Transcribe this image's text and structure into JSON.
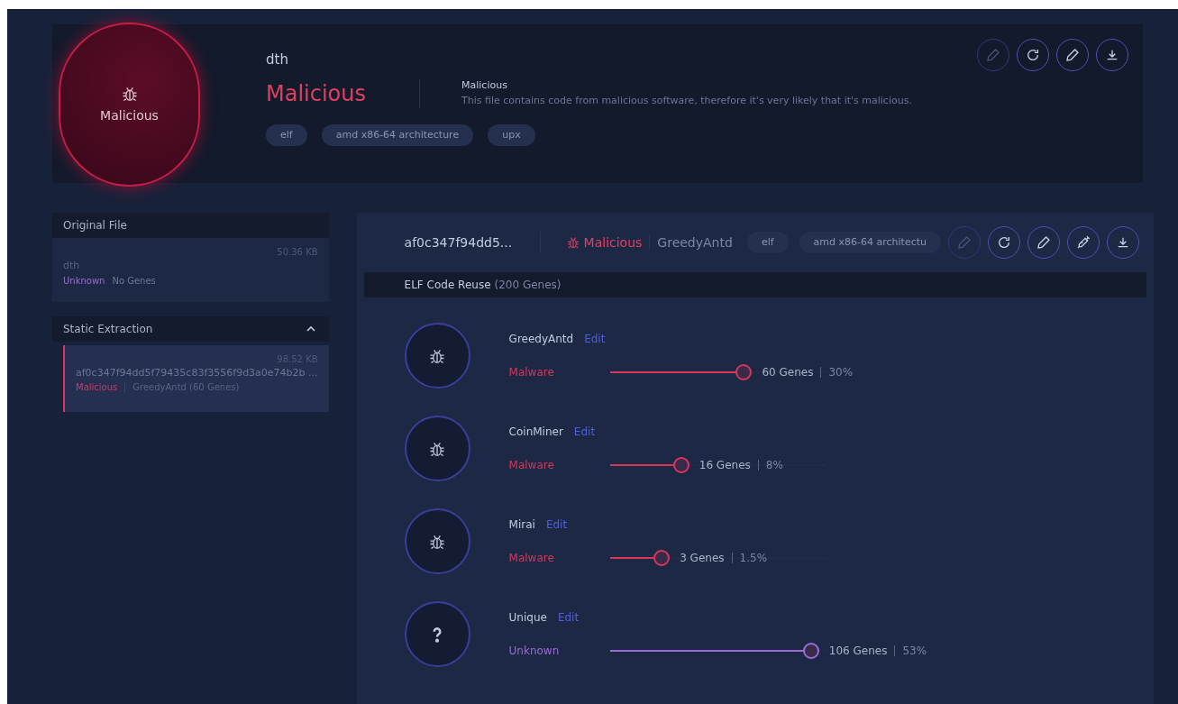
{
  "header": {
    "verdict_badge": "Malicious",
    "file_name": "dth",
    "verdict": "Malicious",
    "verdict_title": "Malicious",
    "verdict_description": "This file contains code from malicious software, therefore it's very likely that it's malicious.",
    "tags": [
      "elf",
      "amd x86-64 architecture",
      "upx"
    ],
    "actions": [
      {
        "kind": "pencil",
        "disabled": true
      },
      {
        "kind": "refresh",
        "disabled": false
      },
      {
        "kind": "pencil",
        "disabled": false
      },
      {
        "kind": "download",
        "disabled": false
      }
    ]
  },
  "sidebar": {
    "original_file": {
      "title": "Original File",
      "size": "50.36 KB",
      "name": "dth",
      "verdict": "Unknown",
      "genes": "No Genes"
    },
    "static_extraction": {
      "title": "Static Extraction",
      "expanded": true,
      "items": [
        {
          "size": "98.52 KB",
          "name": "af0c347f94dd5f79435c83f3556f9d3a0e74b2b ...",
          "verdict": "Malicious",
          "family": "GreedyAntd (60 Genes)",
          "selected": true
        }
      ]
    }
  },
  "detail": {
    "hash": "af0c347f94dd5...",
    "verdict": "Malicious",
    "family": "GreedyAntd",
    "tags": [
      "elf",
      "amd x86-64 architectu"
    ],
    "actions": [
      {
        "kind": "pencil",
        "disabled": true
      },
      {
        "kind": "refresh",
        "disabled": false
      },
      {
        "kind": "pencil",
        "disabled": false
      },
      {
        "kind": "syringe",
        "disabled": false
      },
      {
        "kind": "download",
        "disabled": false
      }
    ],
    "section_title": "ELF Code Reuse",
    "section_count": "(200 Genes)",
    "families": [
      {
        "kind": "bug",
        "name": "GreedyAntd",
        "edit": "Edit",
        "category": "Malware",
        "color": "#d6365b",
        "level": 0.62,
        "reading": "60 Genes",
        "percent": "30%"
      },
      {
        "kind": "bug",
        "name": "CoinMiner",
        "edit": "Edit",
        "category": "Malware",
        "color": "#d6365b",
        "level": 0.33,
        "reading": "16 Genes",
        "percent": "8%"
      },
      {
        "kind": "bug",
        "name": "Mirai",
        "edit": "Edit",
        "category": "Malware",
        "color": "#d6365b",
        "level": 0.24,
        "reading": "3 Genes",
        "percent": "1.5%"
      },
      {
        "kind": "question",
        "name": "Unique",
        "edit": "Edit",
        "category": "Unknown",
        "color": "#9b6bd6",
        "level": 0.93,
        "reading": "106 Genes",
        "percent": "53%"
      }
    ]
  }
}
